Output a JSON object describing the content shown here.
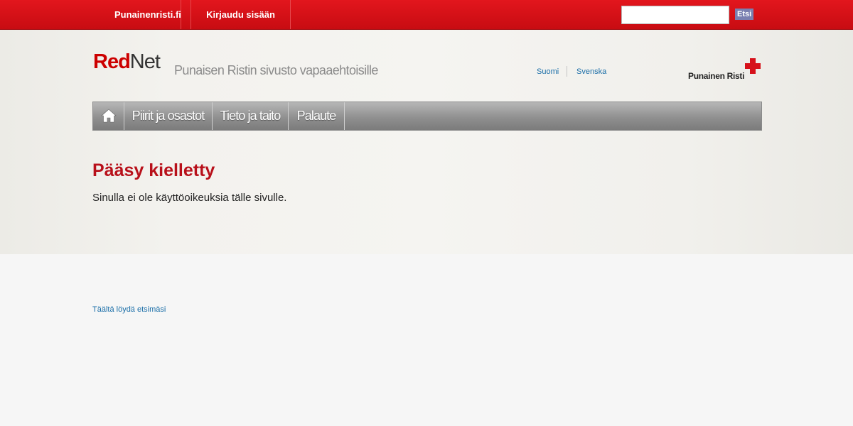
{
  "topbar": {
    "site_link": "Punainenristi.fi",
    "login_link": "Kirjaudu sisään",
    "search_placeholder": "",
    "search_button": "Etsi"
  },
  "header": {
    "logo_red": "Red",
    "logo_net": "Net",
    "tagline": "Punaisen Ristin sivusto vapaaehtoisille",
    "languages": [
      "Suomi",
      "Svenska"
    ],
    "org_logo_text": "Punainen Risti"
  },
  "nav": {
    "home_icon": "home-icon",
    "items": [
      "Piirit ja osastot",
      "Tieto ja taito",
      "Palaute"
    ]
  },
  "main": {
    "title": "Pääsy kielletty",
    "message": "Sinulla ei ole käyttöoikeuksia tälle sivulle."
  },
  "footer": {
    "link": "Täältä löydä etsimäsi"
  },
  "colors": {
    "brand_red": "#cc0000",
    "topbar_red": "#d50f16",
    "link_blue": "#1a6ea8"
  }
}
